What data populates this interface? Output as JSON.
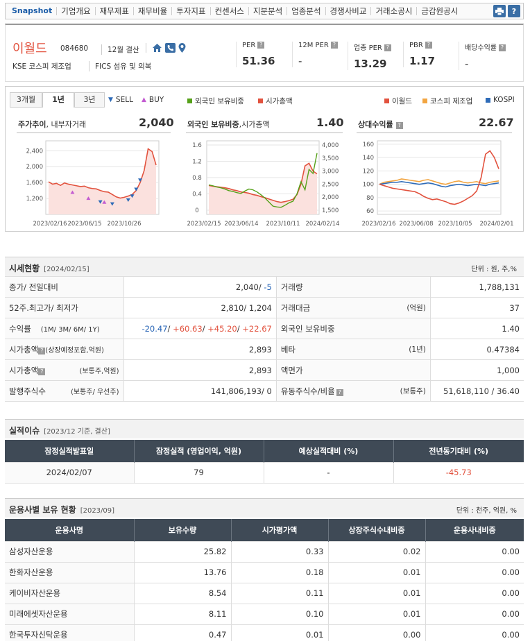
{
  "nav": {
    "items": [
      "Snapshot",
      "기업개요",
      "재무제표",
      "재무비율",
      "투자지표",
      "컨센서스",
      "지분분석",
      "업종분석",
      "경쟁사비교",
      "거래소공시",
      "금감원공시"
    ]
  },
  "company": {
    "name": "이월드",
    "code": "084680",
    "settle": "12월 결산",
    "market": "KSE  코스피 제조업",
    "fics": "FICS 섬유 및 의복"
  },
  "metrics": [
    {
      "label": "PER",
      "value": "51.36"
    },
    {
      "label": "12M PER",
      "value": "-"
    },
    {
      "label": "업종 PER",
      "value": "13.29"
    },
    {
      "label": "PBR",
      "value": "1.17"
    },
    {
      "label": "배당수익률",
      "value": "-"
    }
  ],
  "chart_tabs": {
    "tabs": [
      "3개월",
      "1년",
      "3년"
    ],
    "active": "1년",
    "sell": "SELL",
    "buy": "BUY"
  },
  "legend2": {
    "a": "외국인 보유비중",
    "b": "시가총액"
  },
  "legend3": {
    "a": "이월드",
    "b": "코스피 제조업",
    "c": "KOSPI"
  },
  "colors": {
    "red": "#e2523e",
    "green": "#56a11a",
    "orange": "#f2a541",
    "blue": "#2e6bb8"
  },
  "chart_data": [
    {
      "type": "line",
      "title": "주가추이",
      "subtitle": ", 내부자거래",
      "current": "2,040",
      "x_ticks": [
        "2023/02/16",
        "2023/06/15",
        "2023/10/26"
      ],
      "y_ticks": [
        1200,
        1600,
        2000,
        2400
      ],
      "ylim": [
        800,
        2650
      ],
      "series": [
        {
          "name": "이월드",
          "values": [
            1620,
            1560,
            1580,
            1530,
            1590,
            1560,
            1540,
            1520,
            1500,
            1510,
            1470,
            1450,
            1440,
            1400,
            1370,
            1360,
            1300,
            1240,
            1210,
            1230,
            1260,
            1300,
            1400,
            1600,
            1900,
            2450,
            2380,
            2040
          ]
        }
      ],
      "sell_markers": [
        [
          13,
          1100
        ],
        [
          16,
          1050
        ],
        [
          20,
          1150
        ],
        [
          21,
          1250
        ],
        [
          22,
          1420
        ],
        [
          23,
          1650
        ]
      ],
      "buy_markers": [
        [
          6,
          1350
        ],
        [
          10,
          1200
        ],
        [
          14,
          1100
        ]
      ]
    },
    {
      "type": "line",
      "title": "외국인 보유비중",
      "subtitle": ",시가총액",
      "current": "1.40",
      "x_ticks": [
        "2023/02/15",
        "2023/06/14",
        "2023/10/11",
        "2024/02/14"
      ],
      "y_ticks_left": [
        0,
        0.4,
        0.8,
        1.2,
        1.6
      ],
      "y_ticks_right": [
        "1,500",
        "2,000",
        "2,500",
        "3,000",
        "3,500",
        "4,000"
      ],
      "series": [
        {
          "name": "외국인 보유비중",
          "values": [
            0.62,
            0.6,
            0.57,
            0.55,
            0.52,
            0.48,
            0.46,
            0.43,
            0.41,
            0.47,
            0.52,
            0.5,
            0.45,
            0.38,
            0.3,
            0.2,
            0.1,
            0.08,
            0.07,
            0.12,
            0.18,
            0.22,
            0.4,
            0.7,
            0.5,
            1.0,
            0.9,
            1.4
          ]
        },
        {
          "name": "시가총액",
          "values": [
            2450,
            2420,
            2400,
            2380,
            2360,
            2330,
            2280,
            2250,
            2200,
            2180,
            2150,
            2100,
            2070,
            2020,
            1980,
            1930,
            1880,
            1830,
            1800,
            1830,
            1870,
            1920,
            2100,
            2500,
            3200,
            3300,
            3000,
            2893
          ]
        }
      ]
    },
    {
      "type": "line",
      "title": "상대수익률",
      "current": "22.67",
      "x_ticks": [
        "2023/02/16",
        "2023/06/08",
        "2023/10/05",
        "2024/02/01"
      ],
      "y_ticks": [
        60,
        80,
        100,
        120,
        140,
        160
      ],
      "ylim": [
        55,
        165
      ],
      "series": [
        {
          "name": "이월드",
          "values": [
            100,
            98,
            96,
            94,
            93,
            92,
            91,
            90,
            89,
            86,
            82,
            79,
            77,
            78,
            76,
            74,
            71,
            70,
            72,
            75,
            79,
            83,
            90,
            110,
            145,
            150,
            140,
            123
          ]
        },
        {
          "name": "코스피 제조업",
          "values": [
            100,
            103,
            104,
            105,
            106,
            108,
            107,
            106,
            105,
            104,
            106,
            107,
            105,
            103,
            101,
            100,
            102,
            104,
            105,
            103,
            102,
            103,
            104,
            102,
            101,
            103,
            104,
            105
          ]
        },
        {
          "name": "KOSPI",
          "values": [
            100,
            101,
            102,
            103,
            103,
            104,
            103,
            102,
            101,
            100,
            101,
            102,
            101,
            99,
            97,
            96,
            98,
            99,
            100,
            99,
            98,
            99,
            100,
            99,
            98,
            100,
            101,
            102
          ]
        }
      ]
    }
  ],
  "quote": {
    "title": "시세현황",
    "date": "[2024/02/15]",
    "unit": "단위 : 원, 주,%",
    "rows": [
      {
        "l1": "종가/ 전일대비",
        "l1s": "",
        "v1": "2,040/ ",
        "v1b": "-5",
        "l2": "거래량",
        "l2s": "",
        "v2": "1,788,131"
      },
      {
        "l1": "52주.최고가/ 최저가",
        "l1s": "",
        "v1": "2,810/ 1,204",
        "v1b": "",
        "l2": "거래대금",
        "l2s": "(억원)",
        "v2": "37"
      },
      {
        "l1": "수익률",
        "l1s": "(1M/ 3M/ 6M/ 1Y)",
        "v1": "",
        "v1b": "",
        "l2": "외국인 보유비중",
        "l2s": "",
        "v2": "1.40"
      },
      {
        "l1": "시가총액",
        "l1s": "(상장예정포함,억원)",
        "v1": "2,893",
        "v1b": "",
        "l2": "베타",
        "l2s": "(1년)",
        "v2": "0.47384"
      },
      {
        "l1": "시가총액",
        "l1s": "(보통주,억원)",
        "v1": "2,893",
        "v1b": "",
        "l2": "액면가",
        "l2s": "",
        "v2": "1,000"
      },
      {
        "l1": "발행주식수",
        "l1s": "(보통주/ 우선주)",
        "v1": "141,806,193/ 0",
        "v1b": "",
        "l2": "유동주식수/비율",
        "l2s": "(보통주)",
        "v2": "51,618,110 / 36.40"
      }
    ],
    "returns": [
      "-20.47",
      "+60.63",
      "+45.20",
      "+22.67"
    ]
  },
  "earnings": {
    "title": "실적이슈",
    "sub": "[2023/12 기준, 결산]",
    "headers": [
      "잠정실적발표일",
      "잠정실적 (영업이익, 억원)",
      "예상실적대비 (%)",
      "전년동기대비 (%)"
    ],
    "row": [
      "2024/02/07",
      "79",
      "-",
      "-45.73"
    ]
  },
  "funds": {
    "title": "운용사별 보유 현황",
    "sub": "[2023/09]",
    "unit": "단위 : 천주, 억원, %",
    "headers": [
      "운용사명",
      "보유수량",
      "시가평가액",
      "상장주식수내비중",
      "운용사내비중"
    ],
    "rows": [
      [
        "삼성자산운용",
        "25.82",
        "0.33",
        "0.02",
        "0.00"
      ],
      [
        "한화자산운용",
        "13.76",
        "0.18",
        "0.01",
        "0.00"
      ],
      [
        "케이비자산운용",
        "8.54",
        "0.11",
        "0.01",
        "0.00"
      ],
      [
        "미래에셋자산운용",
        "8.11",
        "0.10",
        "0.01",
        "0.00"
      ],
      [
        "한국투자신탁운용",
        "0.47",
        "0.01",
        "0.00",
        "0.00"
      ]
    ]
  }
}
